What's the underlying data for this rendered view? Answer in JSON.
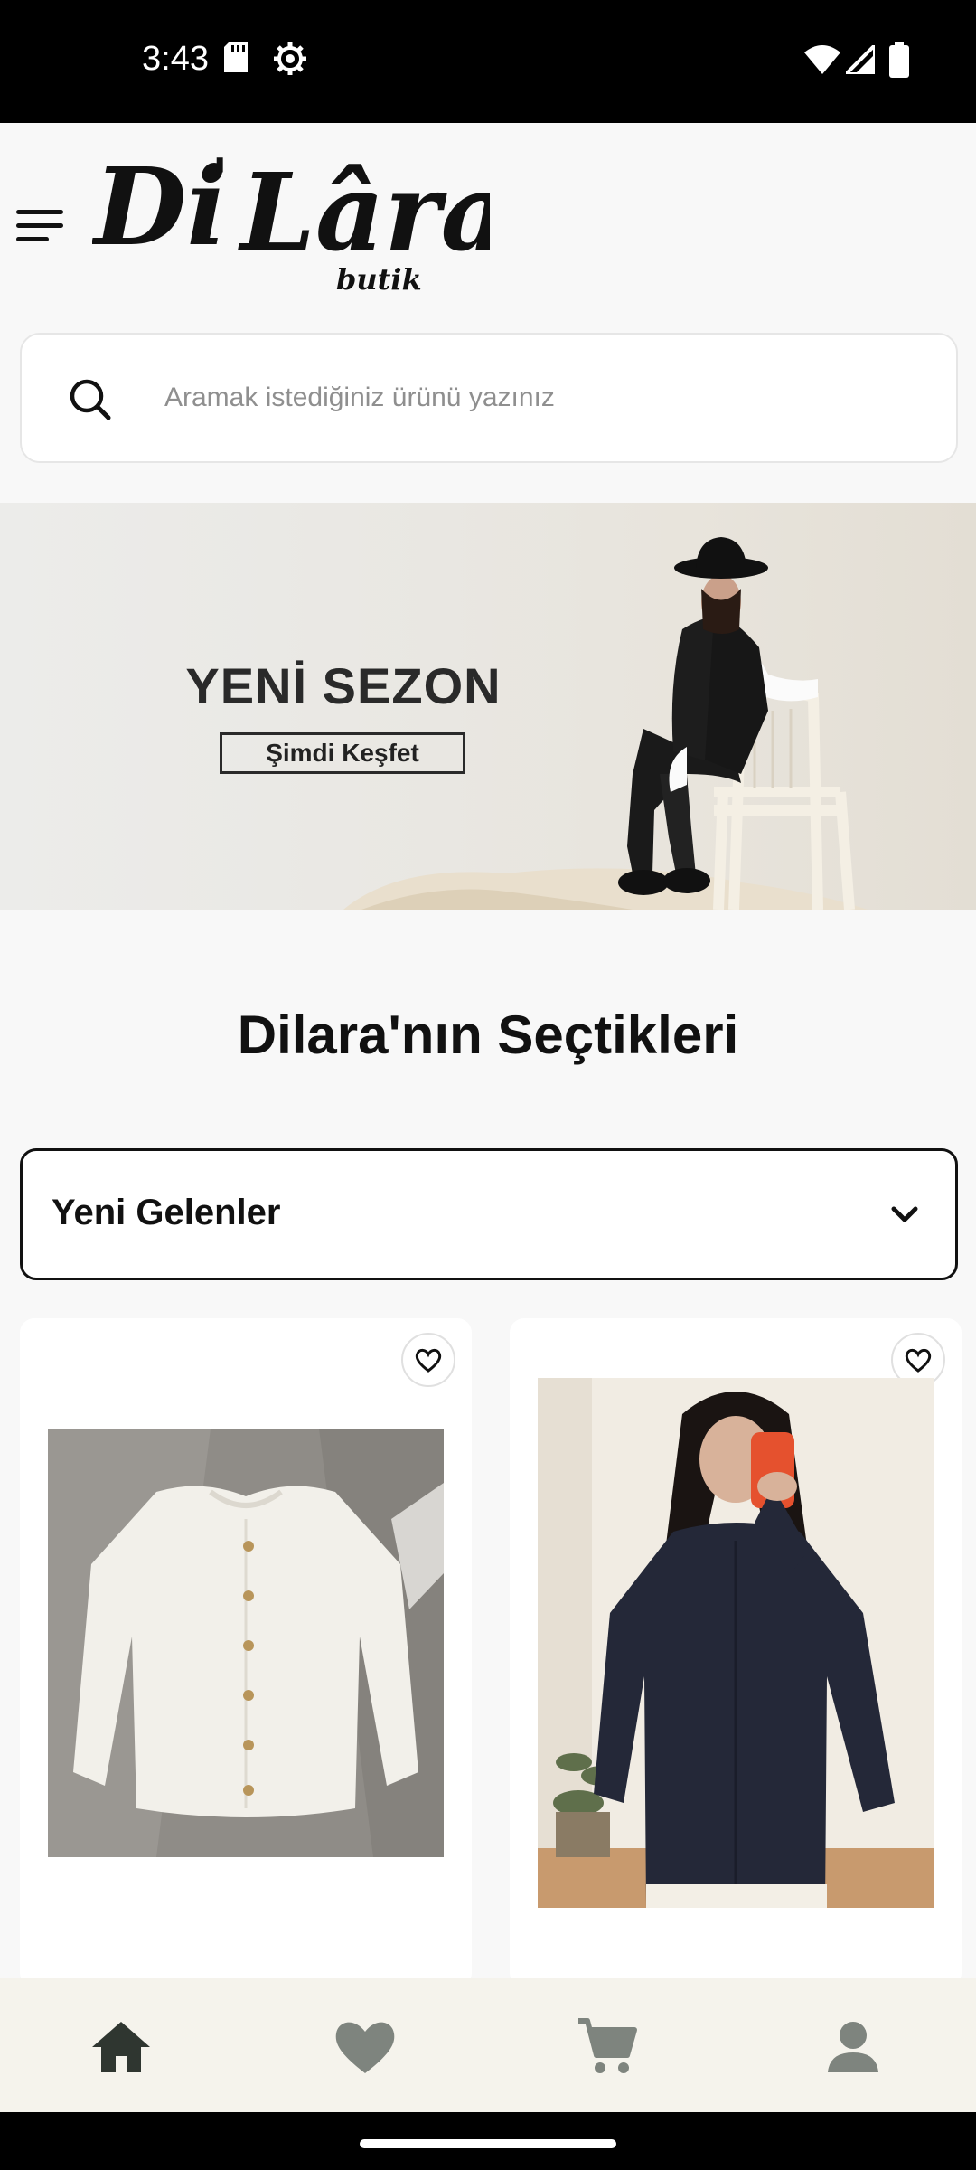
{
  "status_bar": {
    "time": "3:43",
    "icons_left": [
      "sd-card-icon",
      "settings-gear-icon"
    ],
    "icons_right": [
      "wifi-icon",
      "signal-icon",
      "battery-icon"
    ]
  },
  "header": {
    "logo_text": "Di'Lâra",
    "logo_subtext": "butik",
    "menu_icon": "hamburger-menu-icon"
  },
  "search": {
    "placeholder": "Aramak istediğiniz ürünü yazınız",
    "icon": "search-icon"
  },
  "banner": {
    "title": "YENİ SEZON",
    "cta_label": "Şimdi Keşfet"
  },
  "section": {
    "title": "Dilara'nın Seçtikleri"
  },
  "filter": {
    "selected": "Yeni Gelenler",
    "icon": "chevron-down-icon"
  },
  "products": [
    {
      "image": "white-knit-cardigan",
      "favorite_icon": "heart-outline-icon"
    },
    {
      "image": "navy-shirt-model",
      "favorite_icon": "heart-outline-icon"
    }
  ],
  "bottom_nav": {
    "items": [
      "home-icon",
      "favorites-heart-icon",
      "cart-icon",
      "profile-icon"
    ],
    "active_color": "#2f3630",
    "inactive_color": "#7e847e"
  }
}
